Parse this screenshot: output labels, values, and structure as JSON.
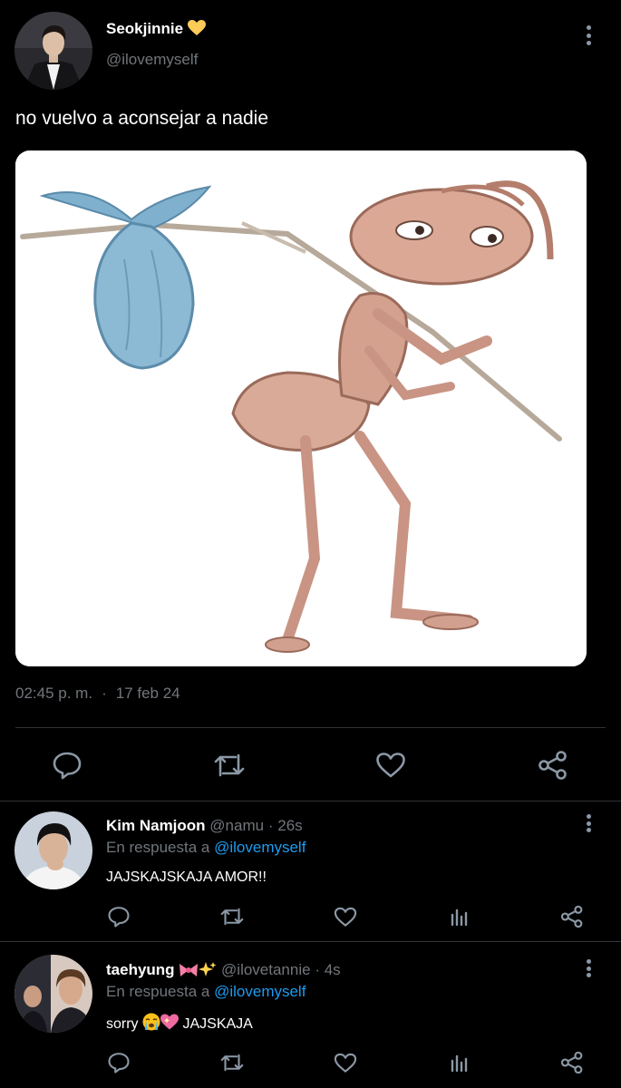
{
  "main_tweet": {
    "display_name": "Seokjinnie",
    "name_emoji": "yellow-heart",
    "handle": "@ilovemyself",
    "text": "no vuelvo a aconsejar a nadie",
    "media_description": "ant-with-bindle-illustration",
    "time": "02:45 p. m.",
    "separator": "·",
    "date": "17 feb 24",
    "actions": [
      "reply-icon",
      "retweet-icon",
      "like-icon",
      "share-icon"
    ]
  },
  "replies": [
    {
      "display_name": "Kim Namjoon",
      "handle": "@namu",
      "separator": "·",
      "age": "26s",
      "reply_prefix": "En respuesta a",
      "reply_to": "@ilovemyself",
      "text": "JAJSKAJSKAJA AMOR!!",
      "actions": [
        "reply-icon",
        "retweet-icon",
        "like-icon",
        "views-icon",
        "share-icon"
      ]
    },
    {
      "display_name": "taehyung",
      "name_emojis": [
        "ribbon",
        "sparkles"
      ],
      "handle": "@ilovetannie",
      "separator": "·",
      "age": "4s",
      "reply_prefix": "En respuesta a",
      "reply_to": "@ilovemyself",
      "text_before": "sorry",
      "text_emojis": [
        "loudly-crying-face",
        "sparkling-heart"
      ],
      "text_after": "JAJSKAJA",
      "actions": [
        "reply-icon",
        "retweet-icon",
        "like-icon",
        "views-icon",
        "share-icon"
      ]
    }
  ],
  "colors": {
    "background": "#000000",
    "text": "#e7e9ea",
    "secondary_text": "#71767b",
    "link": "#1d9bf0",
    "divider": "#2f3336",
    "icon": "#8b98a5"
  }
}
